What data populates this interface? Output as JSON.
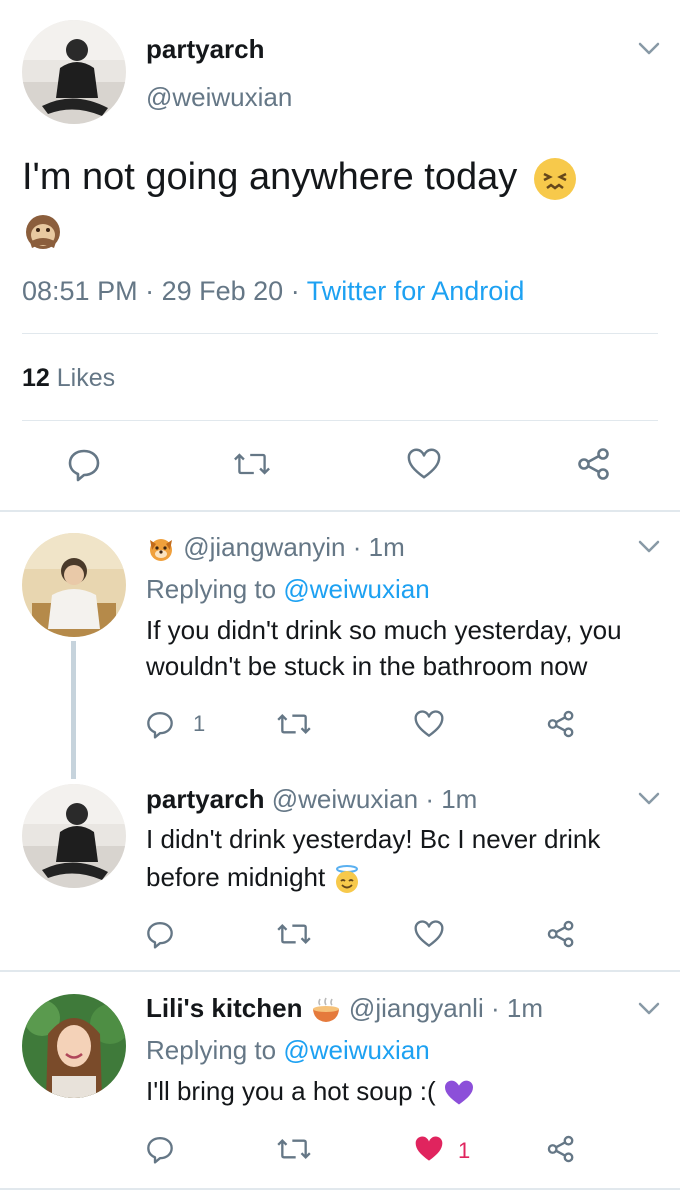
{
  "main_tweet": {
    "display_name": "partyarch",
    "handle": "@weiwuxian",
    "text": "I'm not going anywhere today",
    "time": "08:51 PM",
    "date": "29 Feb 20",
    "source": "Twitter for Android",
    "likes_count": "12",
    "likes_label": "Likes"
  },
  "replies": [
    {
      "display_name": "",
      "handle": "@jiangwanyin",
      "age": "1m",
      "replying_label": "Replying to",
      "replying_to": "@weiwuxian",
      "text_line1": "If you didn't drink so much yesterday, you",
      "text_line2": "wouldn't be stuck in the bathroom now",
      "reply_count": "1",
      "like_count": ""
    },
    {
      "display_name": "partyarch",
      "handle": "@weiwuxian",
      "age": "1m",
      "text_line1": "I didn't drink yesterday! Bc I never drink",
      "text_line2": "before midnight",
      "reply_count": "",
      "like_count": ""
    },
    {
      "display_name": "Lili's kitchen",
      "handle": "@jiangyanli",
      "age": "1m",
      "replying_label": "Replying to",
      "replying_to": "@weiwuxian",
      "text_line1": "I'll bring you a hot soup :(",
      "reply_count": "",
      "like_count": "1"
    }
  ],
  "separator": "·",
  "colors": {
    "text": "#14171a",
    "secondary": "#657786",
    "link": "#1da1f2",
    "like_active": "#e0245e",
    "divider": "#e1e8ed"
  },
  "icons": [
    "chevron-down-icon",
    "reply-icon",
    "retweet-icon",
    "like-icon",
    "share-icon",
    "emoji-confounded",
    "emoji-monkey",
    "emoji-dog",
    "emoji-halo",
    "emoji-soup",
    "emoji-purple-heart"
  ]
}
